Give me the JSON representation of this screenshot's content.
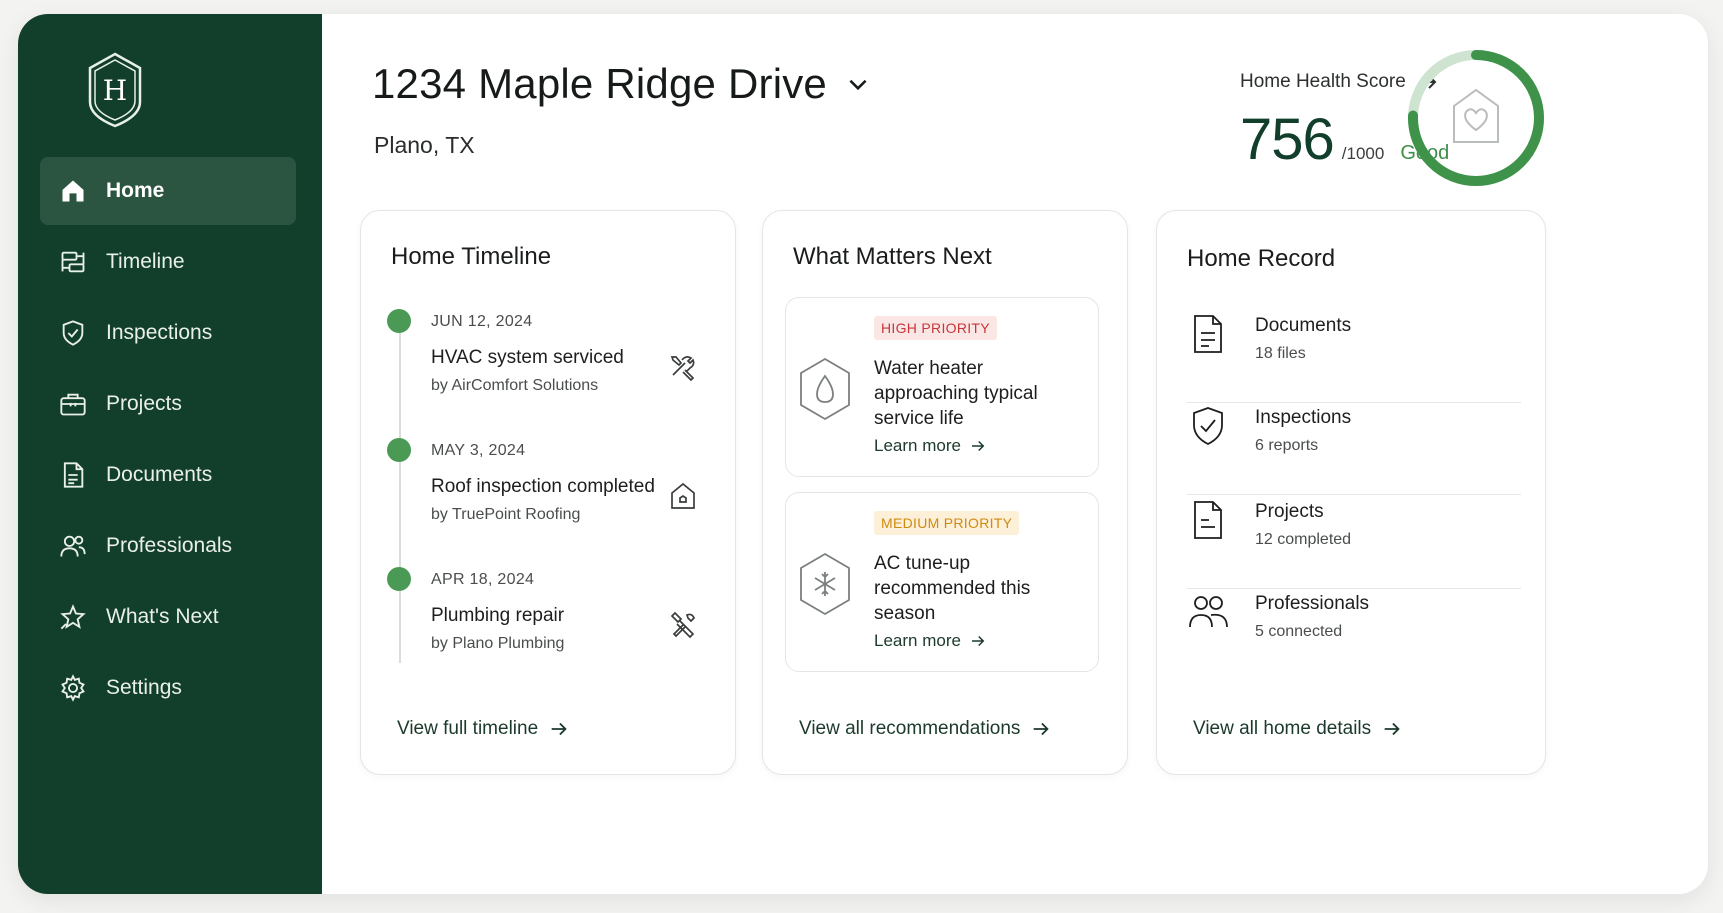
{
  "brand": {
    "logo_letter": "H",
    "sidebar_color": "#123f2b",
    "accent": "#4a9a55"
  },
  "sidebar": {
    "items": [
      {
        "label": "Home",
        "icon": "home-icon",
        "active": true
      },
      {
        "label": "Timeline",
        "icon": "timeline-icon",
        "active": false
      },
      {
        "label": "Inspections",
        "icon": "shield-check-icon",
        "active": false
      },
      {
        "label": "Projects",
        "icon": "toolbox-icon",
        "active": false
      },
      {
        "label": "Documents",
        "icon": "document-icon",
        "active": false
      },
      {
        "label": "Professionals",
        "icon": "people-icon",
        "active": false
      },
      {
        "label": "What's Next",
        "icon": "star-icon",
        "active": false
      },
      {
        "label": "Settings",
        "icon": "gear-icon",
        "active": false
      }
    ]
  },
  "header": {
    "address": "1234 Maple Ridge Drive",
    "city": "Plano, TX",
    "score_label": "Home Health Score",
    "score": "756",
    "score_max": "/1000",
    "score_status": "Good",
    "score_fraction": 0.756
  },
  "timeline": {
    "title": "Home Timeline",
    "items": [
      {
        "date": "JUN 12, 2024",
        "title": "HVAC system serviced",
        "by": "by AirComfort Solutions",
        "icon": "tools-icon"
      },
      {
        "date": "MAY 3, 2024",
        "title": "Roof inspection completed",
        "by": "by TruePoint Roofing",
        "icon": "house-icon"
      },
      {
        "date": "APR 18, 2024",
        "title": "Plumbing repair",
        "by": "by Plano Plumbing",
        "icon": "wrench-icon"
      }
    ],
    "footer": "View full timeline"
  },
  "next": {
    "title": "What Matters Next",
    "items": [
      {
        "priority": "HIGH PRIORITY",
        "level": "high",
        "text": "Water heater approaching typical service life",
        "link": "Learn more",
        "icon": "water-drop-icon"
      },
      {
        "priority": "MEDIUM PRIORITY",
        "level": "medium",
        "text": "AC tune-up recommended this season",
        "link": "Learn more",
        "icon": "snowflake-icon"
      }
    ],
    "footer": "View all recommendations"
  },
  "record": {
    "title": "Home Record",
    "items": [
      {
        "name": "Documents",
        "sub": "18 files",
        "icon": "document-icon"
      },
      {
        "name": "Inspections",
        "sub": "6 reports",
        "icon": "shield-check-icon"
      },
      {
        "name": "Projects",
        "sub": "12 completed",
        "icon": "clipboard-icon"
      },
      {
        "name": "Professionals",
        "sub": "5 connected",
        "icon": "people-icon"
      }
    ],
    "footer": "View all home details"
  }
}
